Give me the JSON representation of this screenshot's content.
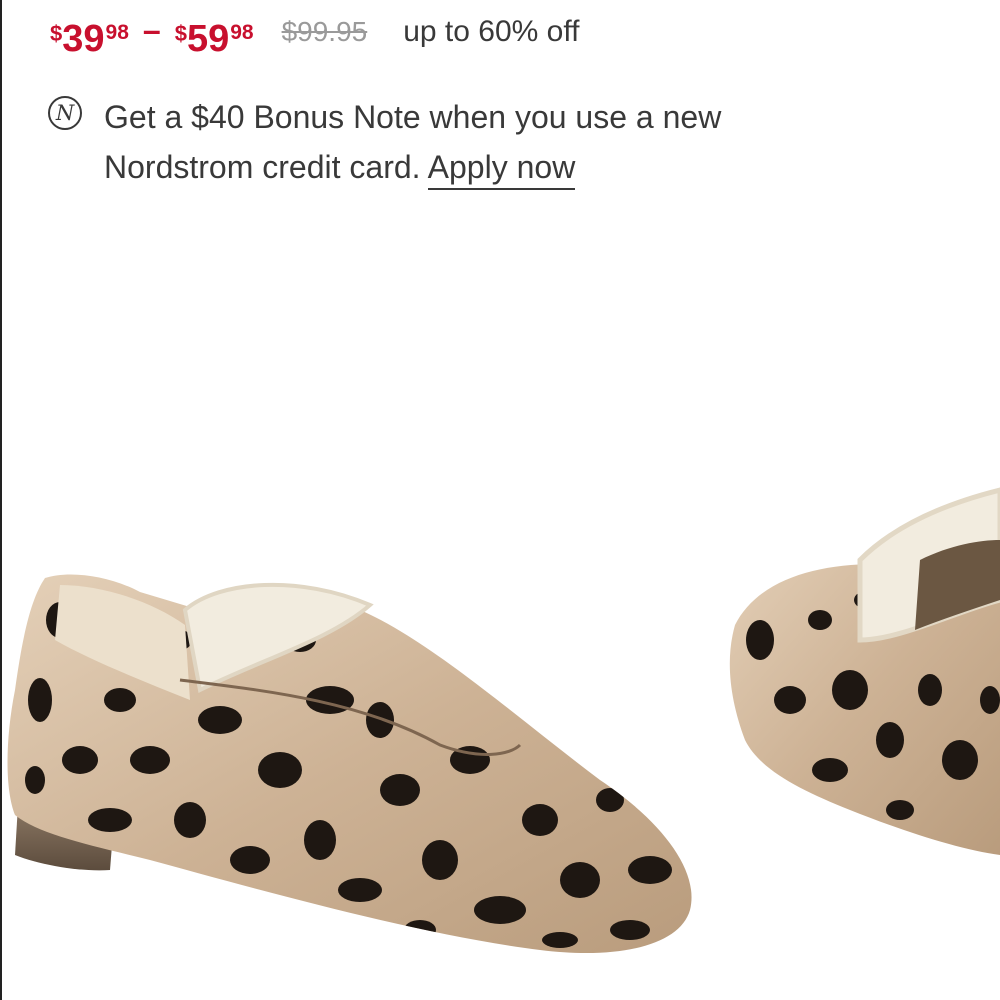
{
  "pricing": {
    "low": {
      "currency": "$",
      "dollars": "39",
      "cents": "98"
    },
    "dash": "–",
    "high": {
      "currency": "$",
      "dollars": "59",
      "cents": "98"
    },
    "original": "$99.95",
    "discount": "up to 60% off",
    "sale_color": "#c8102e"
  },
  "promo": {
    "icon": "nordstrom-n-icon",
    "icon_glyph": "N",
    "text": "Get a $40 Bonus Note when you use a new Nordstrom credit card.",
    "link_label": "Apply now"
  },
  "product_image": {
    "icon": "leopard-loafer-image",
    "colors": {
      "base": "#d8c1a6",
      "spot": "#1e1712",
      "lining": "#f2ecdf"
    }
  }
}
